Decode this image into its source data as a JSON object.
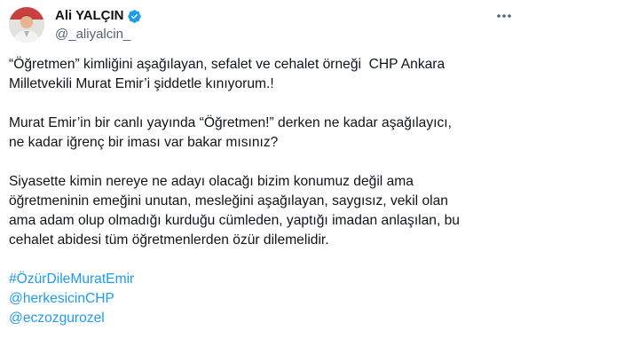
{
  "author": {
    "display_name": "Ali YALÇIN",
    "handle": "@_aliyalcin_",
    "verified": true,
    "verified_color": "#1d9bf0"
  },
  "tweet": {
    "paragraphs": [
      "“Öğretmen” kimliğini aşağılayan, sefalet ve cehalet örneği  CHP Ankara\nMilletvekili Murat Emir’i şiddetle kınıyorum.!",
      "Murat Emir’in bir canlı yayında “Öğretmen!” derken ne kadar aşağılayıcı,\nne kadar iğrenç bir iması var bakar mısınız?",
      "Siyasette kimin nereye ne adayı olacağı bizim konumuz değil ama\nöğretmeninin emeğini unutan, mesleğini aşağılayan, saygısız, vekil olan\nama adam olup olmadığı kurduğu cümleden, yaptığı imadan anlaşılan, bu\ncehalet abidesi tüm öğretmenlerden özür dilemelidir."
    ],
    "hashtag": "#ÖzürDileMuratEmir",
    "mentions": [
      "@herkesicinCHP",
      "@eczozgurozel"
    ],
    "link_color": "#1d9bf0"
  },
  "icons": {
    "more": "more-horizontal-icon",
    "verified": "verified-badge-icon"
  }
}
